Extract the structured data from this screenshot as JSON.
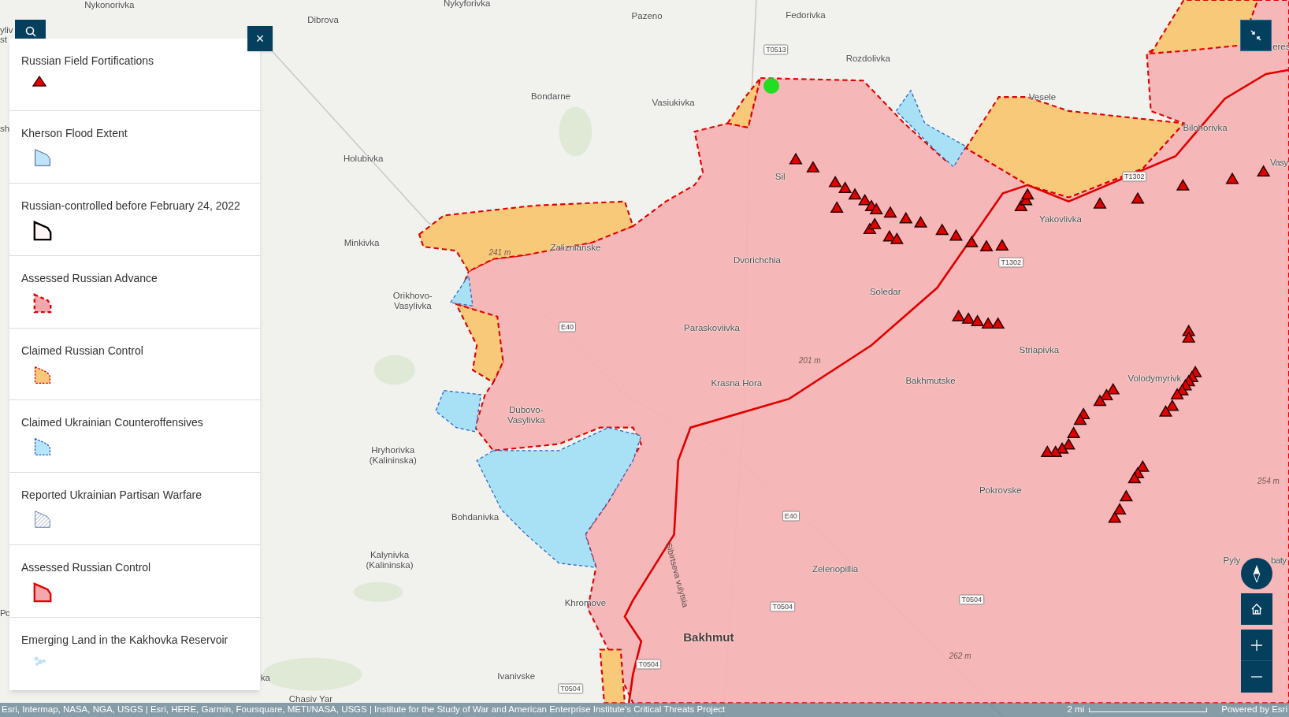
{
  "legend": {
    "close_label": "×",
    "items": [
      {
        "label": "Russian Field Fortifications",
        "kind": "triangle"
      },
      {
        "label": "Kherson Flood Extent",
        "kind": "flood"
      },
      {
        "label": "Russian-controlled before February 24, 2022",
        "kind": "prewar"
      },
      {
        "label": "Assessed Russian Advance",
        "kind": "advance"
      },
      {
        "label": "Claimed Russian Control",
        "kind": "claimed"
      },
      {
        "label": "Claimed Ukrainian Counteroffensives",
        "kind": "counter"
      },
      {
        "label": "Reported Ukrainian Partisan Warfare",
        "kind": "partisan"
      },
      {
        "label": "Assessed Russian Control",
        "kind": "control"
      },
      {
        "label": "Emerging Land in the Kakhovka Reservoir",
        "kind": "emerging"
      }
    ]
  },
  "map": {
    "place_labels": [
      {
        "text": "Nykonorivka"
      },
      {
        "text": "Nykyforivka"
      },
      {
        "text": "Dibrova"
      },
      {
        "text": "Pazeno"
      },
      {
        "text": "Fedorivka"
      },
      {
        "text": "Rozdolivka"
      },
      {
        "text": "Bondarne"
      },
      {
        "text": "Vasiukivka"
      },
      {
        "text": "Vesele"
      },
      {
        "text": "Bilohorivka"
      },
      {
        "text": "Holubivka"
      },
      {
        "text": "Sil"
      },
      {
        "text": "Vasy"
      },
      {
        "text": "Yakovlivka"
      },
      {
        "text": "Minkivka"
      },
      {
        "text": "Zaliznianske"
      },
      {
        "text": "Dvorichchia"
      },
      {
        "text": "Soledar"
      },
      {
        "text": "Orikhovo-Vasylivka"
      },
      {
        "text": "Paraskoviivka"
      },
      {
        "text": "Striapivka"
      },
      {
        "text": "Krasna Hora"
      },
      {
        "text": "Bakhmutske"
      },
      {
        "text": "Volodymyrivk"
      },
      {
        "text": "Dubovo-Vasylivka"
      },
      {
        "text": "Hryhorivka (Kalininska)"
      },
      {
        "text": "Pokrovske"
      },
      {
        "text": "Bohdanivka"
      },
      {
        "text": "Kalynivka (Kalininska)"
      },
      {
        "text": "Pyly"
      },
      {
        "text": "baty"
      },
      {
        "text": "Zelenopillia"
      },
      {
        "text": "Khromove"
      },
      {
        "text": "Sibirtseva vulytsia"
      },
      {
        "text": "Bakhmut"
      },
      {
        "text": "Ivanivske"
      },
      {
        "text": "Chasiv Yar"
      },
      {
        "text": "eres"
      },
      {
        "text": "yliv"
      },
      {
        "text": "st"
      },
      {
        "text": "sh"
      },
      {
        "text": "Po"
      },
      {
        "text": "ka"
      }
    ],
    "road_shields": [
      {
        "text": "T0513"
      },
      {
        "text": "T1302"
      },
      {
        "text": "T1302"
      },
      {
        "text": "E40"
      },
      {
        "text": "E40"
      },
      {
        "text": "T0504"
      },
      {
        "text": "T0504"
      },
      {
        "text": "T0504"
      },
      {
        "text": "T0504"
      }
    ],
    "elevations": [
      {
        "text": "241 m"
      },
      {
        "text": "201 m"
      },
      {
        "text": "254 m"
      },
      {
        "text": "262 m"
      }
    ]
  },
  "controls": [
    {
      "kind": "compass"
    },
    {
      "kind": "home"
    },
    {
      "kind": "zoom_in"
    },
    {
      "kind": "zoom_out"
    }
  ],
  "attribution": {
    "text": "Esri, Intermap, NASA, NGA, USGS | Esri, HERE, Garmin, Foursquare, METI/NASA, USGS | Institute for the Study of War and American Enterprise Institute's Critical Threats Project",
    "scale": "2 mi",
    "powered_by": "Powered by Esri"
  }
}
